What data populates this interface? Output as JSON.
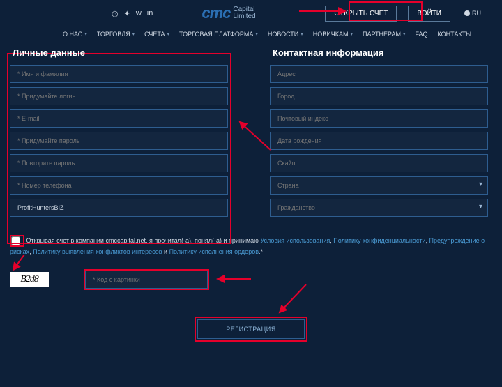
{
  "header": {
    "logo_main": "cmc",
    "logo_sub1": "Capital",
    "logo_sub2": "Limited",
    "open_account": "ОТКРЫТЬ СЧЕТ",
    "login": "ВОЙТИ",
    "lang": "RU"
  },
  "nav": {
    "about": "О НАС",
    "trade": "ТОРГОВЛЯ",
    "accounts": "СЧЕТА",
    "platform": "ТОРГОВАЯ ПЛАТФОРМА",
    "news": "НОВОСТИ",
    "newbies": "НОВИЧКАМ",
    "partners": "ПАРТНЁРАМ",
    "faq": "FAQ",
    "contacts": "КОНТАКТЫ"
  },
  "personal": {
    "title": "Личные данные",
    "name": "* Имя и фамилия",
    "login": "* Придумайте логин",
    "email": "* E-mail",
    "password": "* Придумайте пароль",
    "password2": "* Повторите пароль",
    "phone": "* Номер телефона",
    "referral": "ProfitHuntersBIZ"
  },
  "contact": {
    "title": "Контактная информация",
    "address": "Адрес",
    "city": "Город",
    "zip": "Почтовый индекс",
    "dob": "Дата рождения",
    "skype": "Скайп",
    "country": "Страна",
    "citizenship": "Гражданство"
  },
  "consent": {
    "text_pre": "Открывая счет в компании cmccapital.net, я прочитал(-а), понял(-а) и принимаю ",
    "terms": "Условия использования",
    "sep1": ", ",
    "privacy": "Политику конфиденциальности",
    "sep2": ", ",
    "risk": "Предупреждение о рисках",
    "sep3": ", ",
    "conflict": "Политику выявления конфликтов интересов",
    "sep4": " и ",
    "orders": "Политику исполнения ордеров",
    "end": ".*"
  },
  "captcha": {
    "code_img": "B2d8",
    "placeholder": "* Код с картинки"
  },
  "submit": "РЕГИСТРАЦИЯ"
}
